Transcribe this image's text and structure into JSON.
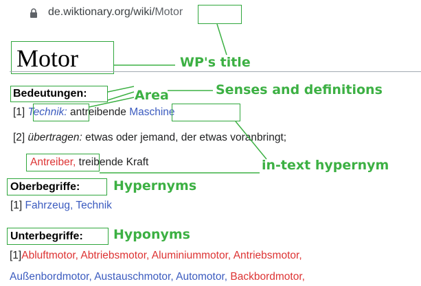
{
  "browser": {
    "url_domain": "de.wiktionary.org/wiki/",
    "url_slug": "Motor"
  },
  "page": {
    "title": "Motor",
    "bedeutungen": {
      "heading": "Bedeutungen:",
      "sense1": {
        "num": "[1]",
        "field": "Technik:",
        "text": "antreibende",
        "link": "Maschine"
      },
      "sense2": {
        "num": "[2]",
        "qualifier": "übertragen:",
        "text": "etwas oder jemand, der etwas voranbringt;",
        "link": "Antreiber,",
        "rest": "treibende Kraft"
      }
    },
    "oberbegriffe": {
      "heading": "Oberbegriffe:",
      "num": "[1]",
      "items": [
        "Fahrzeug,",
        "Technik"
      ]
    },
    "unterbegriffe": {
      "heading": "Unterbegriffe:",
      "num": "[1]",
      "line1": [
        "Abluftmotor,",
        "Abtriebsmotor,",
        "Aluminiummotor,",
        "Antriebsmotor,"
      ],
      "line2": [
        "Außenbordmotor,",
        "Austauschmotor,",
        "Automotor,",
        "Backbordmotor,"
      ]
    }
  },
  "annotations": {
    "title": "WP's title",
    "area": "Area",
    "senses": "Senses and definitions",
    "hypernym_intext": "in-text hypernym",
    "hypernyms": "Hypernyms",
    "hyponyms": "Hyponyms"
  },
  "colors": {
    "annotation": "#3cb043",
    "link_blue": "#3b5bbf",
    "link_red": "#dd3333"
  }
}
